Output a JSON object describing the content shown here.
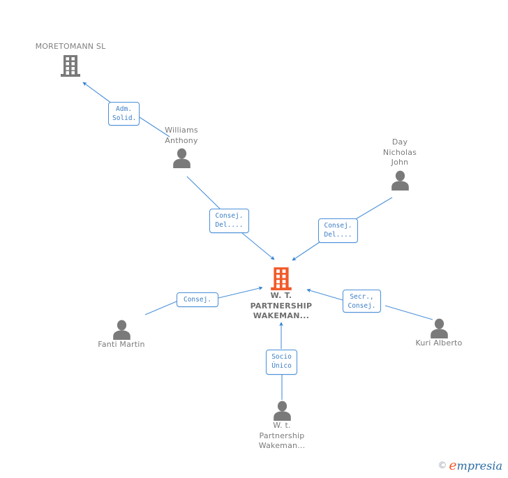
{
  "diagram": {
    "type": "corporate-relationship-network",
    "background_color": "#ffffff",
    "edge_color": "#4a90d9",
    "company_icon_color": "#7a7a7a",
    "center_icon_color": "#f15a29",
    "person_icon_color": "#7a7a7a",
    "label_text_color": "#3b7dc4",
    "node_text_color": "#7a7a7a"
  },
  "nodes": {
    "moretomann": {
      "name": "MORETOMANN SL",
      "icon": "building-icon",
      "kind": "company"
    },
    "center": {
      "name": "W. T.\nPARTNERSHIP\nWAKEMAN...",
      "icon": "building-icon",
      "kind": "company-focus"
    },
    "williams": {
      "name": "Williams\nAnthony",
      "icon": "person-icon",
      "kind": "person"
    },
    "day": {
      "name": "Day\nNicholas\nJohn",
      "icon": "person-icon",
      "kind": "person"
    },
    "fanti": {
      "name": "Fanti Martin",
      "icon": "person-icon",
      "kind": "person"
    },
    "kuri": {
      "name": "Kuri Alberto",
      "icon": "person-icon",
      "kind": "person"
    },
    "wtpartner": {
      "name": "W. t.\nPartnership\nWakeman...",
      "icon": "person-icon",
      "kind": "person"
    }
  },
  "edge_labels": {
    "adm_solid": "Adm.\nSolid.",
    "consej_del_left": "Consej.\nDel....",
    "consej_del_right": "Consej.\nDel....",
    "consej": "Consej.",
    "secr_consej": "Secr.,\nConsej.",
    "socio_unico": "Socio\nÚnico"
  },
  "watermark": {
    "copyright": "©",
    "brand_initial": "e",
    "brand_rest": "mpresia"
  }
}
